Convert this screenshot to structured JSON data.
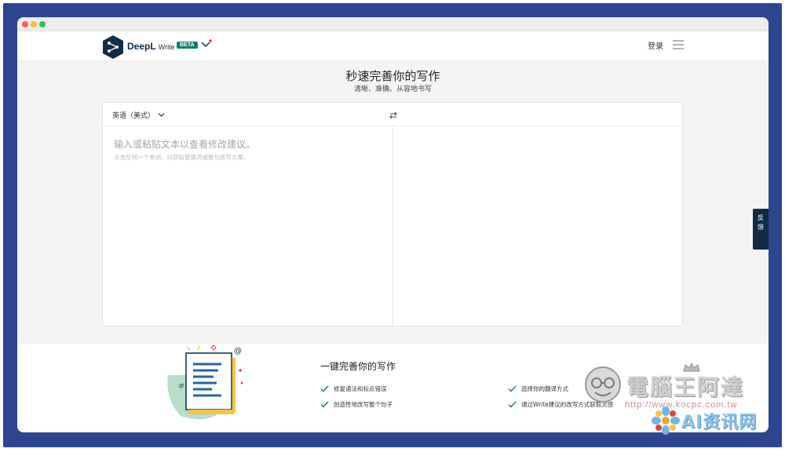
{
  "header": {
    "brand": "DeepL",
    "product": "Write",
    "badge": "BETA",
    "login_label": "登录"
  },
  "hero": {
    "title": "秒速完善你的写作",
    "subtitle": "清晰、准确、从容地书写"
  },
  "editor": {
    "source_language": "英语（美式）",
    "input_placeholder": "输入或粘贴文本以查看修改建议。",
    "input_hint": "点击任何一个单词，以获取替换词或整句改写方案。"
  },
  "feedback": {
    "label": "反馈"
  },
  "features": {
    "title": "一键完善你的写作",
    "items": [
      "修复语法和标点错误",
      "创造性地改写整个句子",
      "选择你的翻译方式",
      "通过Write建议的改写方式获取灵感"
    ]
  },
  "watermark": {
    "brand": "電腦王阿達",
    "url": "http://www.kocpc.com.tw",
    "ai_text": "AI资讯网"
  },
  "colors": {
    "frame": "#2d4490",
    "brand_dark": "#0f2b46",
    "badge_green": "#0f7d6a",
    "check_green": "#0f7d6a"
  },
  "icons": [
    "deepl-logo-icon",
    "chevron-down-icon",
    "menu-icon",
    "swap-icon",
    "check-icon",
    "document-illustration"
  ]
}
